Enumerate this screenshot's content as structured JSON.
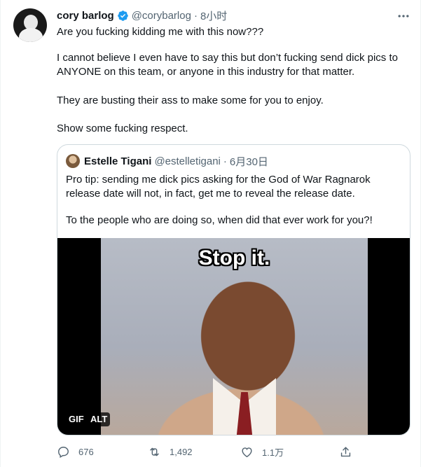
{
  "tweet": {
    "author": {
      "name": "cory barlog",
      "handle": "@corybarlog",
      "time": "8小时"
    },
    "paragraphs": [
      "Are you fucking kidding me with this now???",
      "I cannot believe I even have to say this but don’t fucking send dick pics to ANYONE on this team, or anyone in this industry for that matter.",
      "They are busting their ass to make some for you to enjoy.",
      "Show some fucking respect."
    ],
    "quoted": {
      "author": {
        "name": "Estelle Tigani",
        "handle": "@estelletigani",
        "time": "6月30日"
      },
      "paragraphs": [
        "Pro tip: sending me dick pics asking for the God of War Ragnarok release date will not, in fact, get me to reveal the release date.",
        "To the people who are doing so, when did that ever work for you?!"
      ],
      "media": {
        "caption": "Stop it.",
        "badges": [
          "GIF",
          "ALT"
        ]
      }
    },
    "actions": {
      "replies": "676",
      "retweets": "1,492",
      "likes": "1.1万"
    },
    "icons": {
      "verified": "verified-badge-icon",
      "more": "more-horizontal-icon",
      "reply": "reply-icon",
      "retweet": "retweet-icon",
      "like": "heart-icon",
      "share": "share-icon"
    },
    "colors": {
      "verified": "#1d9bf0",
      "muted": "#536471",
      "text": "#0f1419",
      "border": "#cfd9de"
    }
  }
}
